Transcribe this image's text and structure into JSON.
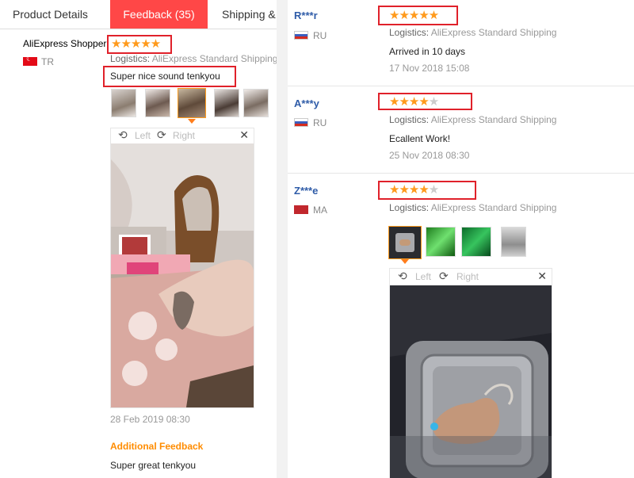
{
  "tabs": [
    {
      "label": "Product Details"
    },
    {
      "label": "Feedback (35)"
    },
    {
      "label": "Shipping &"
    }
  ],
  "left_review": {
    "name": "AliExpress Shopper",
    "country": "TR",
    "rating": 5,
    "stars": "★★★★★",
    "logistics_label": "Logistics:",
    "logistics_value": "AliExpress Standard Shipping",
    "text": "Super nice sound tenkyou",
    "thumbnails": 5,
    "viewer": {
      "left": "Left",
      "right": "Right",
      "close": "✕"
    },
    "date": "28 Feb 2019 08:30",
    "additional_label": "Additional Feedback",
    "additional_text": "Super great tenkyou"
  },
  "right_reviews": [
    {
      "name": "R***r",
      "country": "RU",
      "rating": 5,
      "stars_on": "★★★★★",
      "stars_off": "",
      "logistics_label": "Logistics:",
      "logistics_value": "AliExpress Standard Shipping",
      "text": "Arrived in 10 days",
      "date": "17 Nov 2018 15:08"
    },
    {
      "name": "A***y",
      "country": "RU",
      "rating": 4,
      "stars_on": "★★★★",
      "stars_off": "★",
      "logistics_label": "Logistics:",
      "logistics_value": "AliExpress Standard Shipping",
      "text": "Ecallent Work!",
      "date": "25 Nov 2018 08:30"
    },
    {
      "name": "Z***e",
      "country": "MA",
      "rating": 4,
      "stars_on": "★★★★",
      "stars_off": "★",
      "logistics_label": "Logistics:",
      "logistics_value": "AliExpress Standard Shipping",
      "viewer": {
        "left": "Left",
        "right": "Right",
        "close": "✕"
      }
    }
  ],
  "icons": {
    "rotate_left": "⟲",
    "rotate_right": "⟳"
  },
  "colors": {
    "tab_active": "#ff4747",
    "star": "#ff9a1c",
    "highlight_box": "#e0212a",
    "username": "#2f5ca8",
    "additional_feedback": "#ff8c00"
  }
}
